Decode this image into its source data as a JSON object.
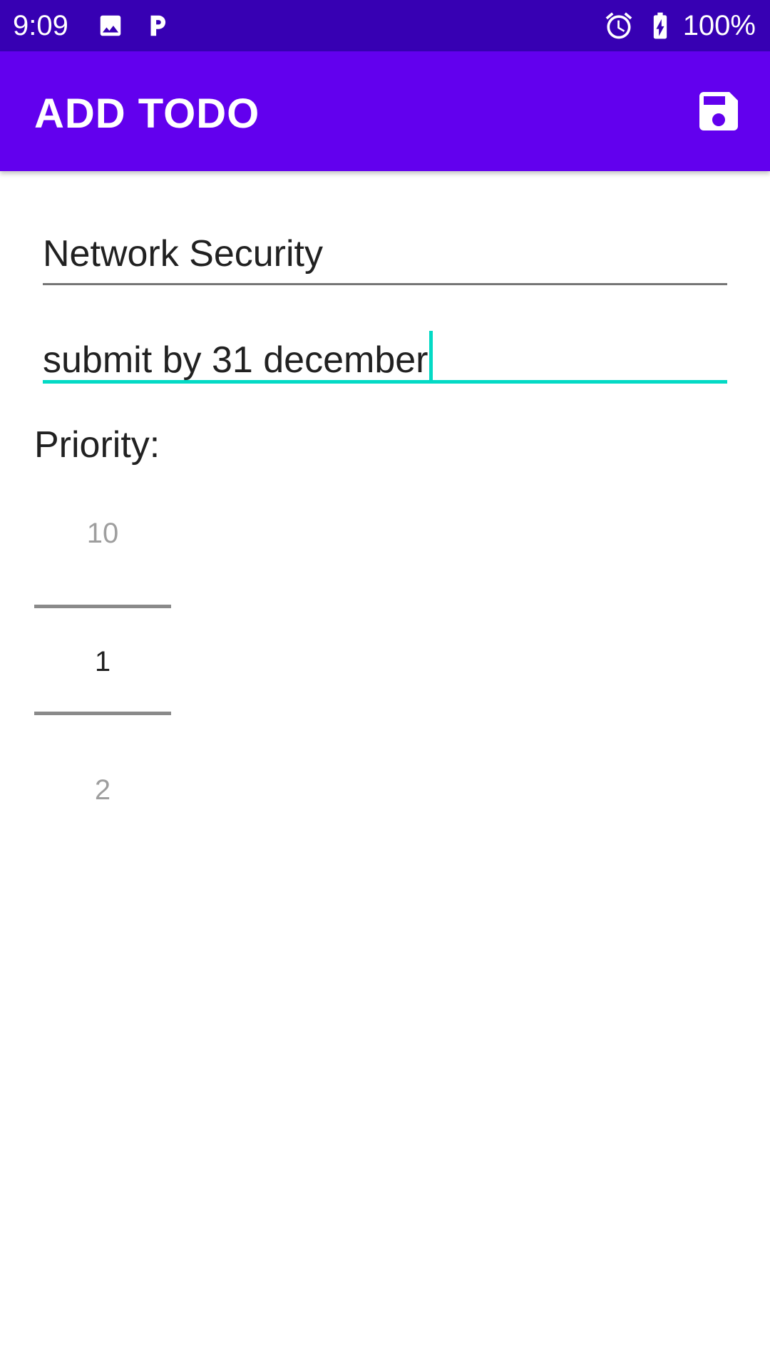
{
  "status_bar": {
    "time": "9:09",
    "battery_percent": "100%",
    "left_icons": [
      "image-icon",
      "parking-icon"
    ],
    "right_icons": [
      "alarm-icon",
      "battery-charging-icon"
    ],
    "background_color": "#3700b3"
  },
  "app_bar": {
    "title": "ADD TODO",
    "action_icon": "save-icon",
    "background_color": "#6200ee"
  },
  "form": {
    "title_value": "Network Security",
    "description_value": "submit by 31 december",
    "accent_color": "#03dac5"
  },
  "priority": {
    "label": "Priority:",
    "prev_value": "10",
    "selected_value": "1",
    "next_value": "2"
  }
}
